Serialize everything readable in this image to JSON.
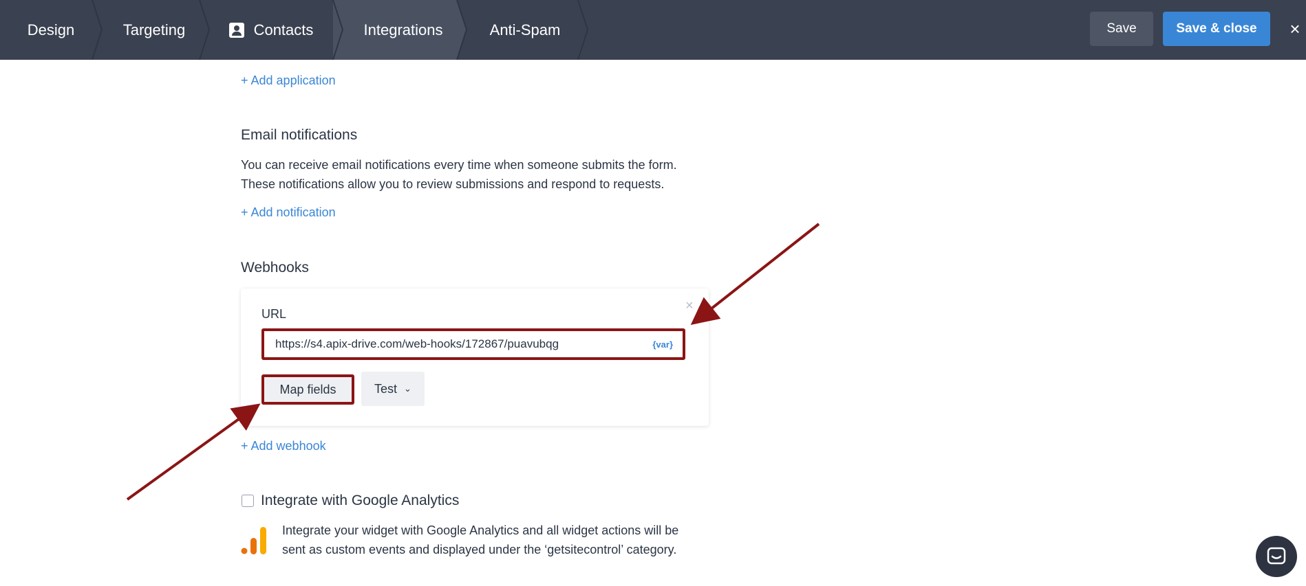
{
  "topbar": {
    "steps": [
      {
        "label": "Design"
      },
      {
        "label": "Targeting"
      },
      {
        "label": "Contacts"
      },
      {
        "label": "Integrations"
      },
      {
        "label": "Anti-Spam"
      }
    ],
    "save_label": "Save",
    "save_close_label": "Save & close",
    "close_icon": "×"
  },
  "main": {
    "add_application": "+ Add application",
    "email": {
      "title": "Email notifications",
      "line1": "You can receive email notifications every time when someone submits the form.",
      "line2": "These notifications allow you to review submissions and respond to requests.",
      "add_link": "+ Add notification"
    },
    "webhooks": {
      "title": "Webhooks",
      "url_label": "URL",
      "url_value": "https://s4.apix-drive.com/web-hooks/172867/puavubqg",
      "var_tag": "{var}",
      "map_fields": "Map fields",
      "test": "Test",
      "chevron": "⌄",
      "add_link": "+ Add webhook",
      "close_icon": "×"
    },
    "ga": {
      "checkbox_label": "Integrate with Google Analytics",
      "line1": "Integrate your widget with Google Analytics and all widget actions will be",
      "line2": "sent as custom events and displayed under the ‘getsitecontrol’ category."
    }
  },
  "colors": {
    "topbar": "#3a4150",
    "accent": "#3a86d6",
    "annotation": "#8b1515"
  }
}
